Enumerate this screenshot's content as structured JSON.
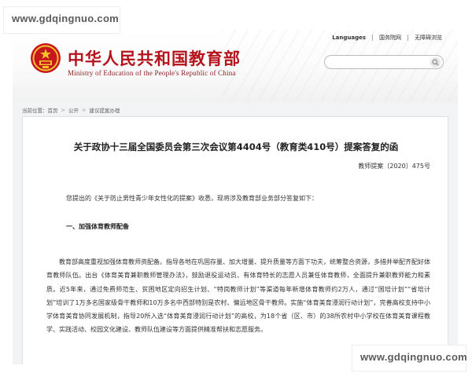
{
  "watermark": {
    "top": "www.gdqingnuo.com",
    "bottom": "www.gdqingnuo.com"
  },
  "header": {
    "title_cn": "中华人民共和国教育部",
    "title_en": "Ministry of Education of the People's Republic of China",
    "toplinks": [
      "Languages",
      "国务院网",
      "无障碍浏览"
    ],
    "search_placeholder": "",
    "brand_color": "#b5121b"
  },
  "breadcrumb": [
    "当前位置：首页",
    "公开",
    "建议提案办理"
  ],
  "document": {
    "title": "关于政协十三届全国委员会第三次会议第4404号（教育类410号）提案答复的函",
    "number": "教师提案〔2020〕475号",
    "intro": "您提出的《关于防止男性青少年女性化的提案》收悉，现将涉及教育部业务部分答复如下：",
    "section1_heading": "一、加强体育教师配备",
    "section1_paragraph": "教育部高度重视加强体育教师资配备。指导各地在巩固存量、加大增量、提升质量等方面下功夫，统筹整合资源，多措并举配齐配好体育教师队伍。出台《体育美育兼职教师管理办法》，鼓励退役运动员、有体育特长的志愿人员兼任体育教师，全面提升兼职教师能力和素质。近5年来，通过免费师范生、贫困地区定向招生计划、“特岗教师计划”等渠道每年新增体育教师约2万人，通过“国培计划”“省培计划”培训了1万多名国家级骨干教师和10万多名中西部特别是农村、偏远地区骨干教师。实施“体育美育浸润行动计划”，完善高校支持中小学体育美育协同发展机制，指导20所入选“体育美育浸润行动计划”的高校，为18个省（区、市）的38所农村中小学校在体育美育课程教学、实践活动、校园文化建设、教师队伍建设等方面提供精准帮扶和志愿服务。"
  }
}
